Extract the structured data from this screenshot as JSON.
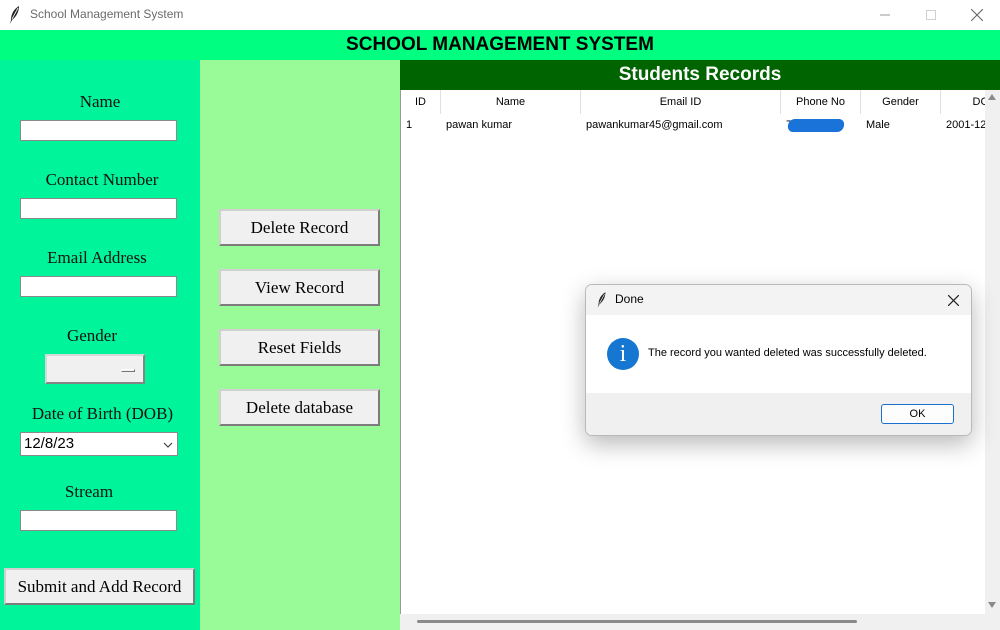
{
  "window": {
    "title": "School Management System"
  },
  "header": {
    "title": "SCHOOL MANAGEMENT SYSTEM"
  },
  "form": {
    "name_label": "Name",
    "name_value": "",
    "contact_label": "Contact Number",
    "contact_value": "",
    "email_label": "Email Address",
    "email_value": "",
    "gender_label": "Gender",
    "gender_value": "",
    "dob_label": "Date of Birth (DOB)",
    "dob_value": "12/8/23",
    "stream_label": "Stream",
    "stream_value": "",
    "submit_label": "Submit and Add Record"
  },
  "actions": {
    "delete_record": "Delete Record",
    "view_record": "View Record",
    "reset_fields": "Reset Fields",
    "delete_database": "Delete database"
  },
  "records": {
    "title": "Students Records",
    "columns": [
      "ID",
      "Name",
      "Email ID",
      "Phone No",
      "Gender",
      "DC"
    ],
    "rows": [
      {
        "id": "1",
        "name": "pawan kumar",
        "email": "pawankumar45@gmail.com",
        "phone": "7…2",
        "gender": "Male",
        "dob": "2001-12"
      }
    ]
  },
  "dialog": {
    "title": "Done",
    "message": "The record you wanted deleted was successfully deleted.",
    "ok_label": "OK",
    "icon": "info-icon"
  },
  "colors": {
    "banner": "#00ff80",
    "left_panel": "#00f59a",
    "mid_panel": "#98fb98",
    "records_header": "#006400"
  }
}
